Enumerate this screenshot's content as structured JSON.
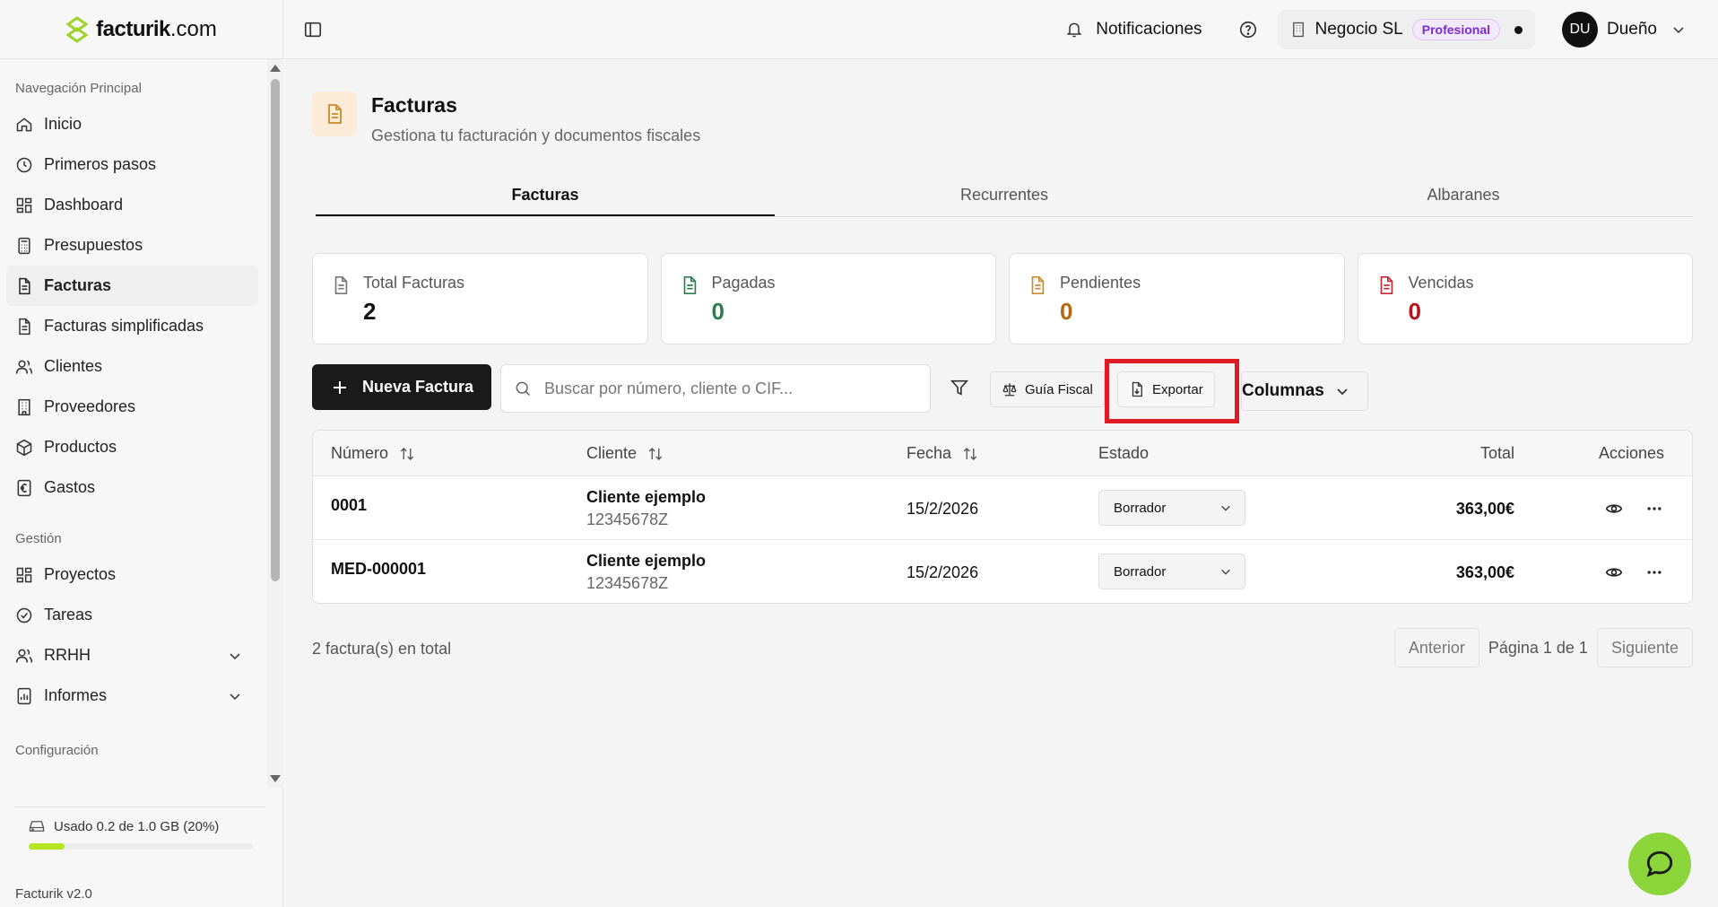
{
  "logo": {
    "brand": "facturik",
    "tld": ".com"
  },
  "sidebar": {
    "section_main": "Navegación Principal",
    "main_items": [
      {
        "label": "Inicio",
        "icon": "home-icon"
      },
      {
        "label": "Primeros pasos",
        "icon": "clock-icon"
      },
      {
        "label": "Dashboard",
        "icon": "dashboard-icon"
      },
      {
        "label": "Presupuestos",
        "icon": "calculator-icon"
      },
      {
        "label": "Facturas",
        "icon": "invoice-icon",
        "active": true
      },
      {
        "label": "Facturas simplificadas",
        "icon": "invoice-icon"
      },
      {
        "label": "Clientes",
        "icon": "users-icon"
      },
      {
        "label": "Proveedores",
        "icon": "building-icon"
      },
      {
        "label": "Productos",
        "icon": "box-icon"
      },
      {
        "label": "Gastos",
        "icon": "euro-receipt-icon"
      }
    ],
    "section_manage": "Gestión",
    "manage_items": [
      {
        "label": "Proyectos",
        "icon": "dashboard-icon"
      },
      {
        "label": "Tareas",
        "icon": "check-circle-icon"
      },
      {
        "label": "RRHH",
        "icon": "users-icon"
      },
      {
        "label": "Informes",
        "icon": "report-icon"
      }
    ],
    "section_config": "Configuración",
    "usage_text": "Usado 0.2 de 1.0 GB (20%)",
    "usage_fraction": 0.16,
    "version": "Facturik v2.0"
  },
  "header": {
    "notifications": "Notificaciones",
    "business": "Negocio SL",
    "plan": "Profesional",
    "avatar_initials": "DU",
    "user_role": "Dueño"
  },
  "page": {
    "title": "Facturas",
    "subtitle": "Gestiona tu facturación y documentos fiscales"
  },
  "tabs": [
    "Facturas",
    "Recurrentes",
    "Albaranes"
  ],
  "stats": [
    {
      "label": "Total Facturas",
      "value": "2",
      "color": "#111111",
      "icon_color": "#777777"
    },
    {
      "label": "Pagadas",
      "value": "0",
      "color": "#2e7d4f",
      "icon_color": "#2e7d4f"
    },
    {
      "label": "Pendientes",
      "value": "0",
      "color": "#b8650f",
      "icon_color": "#c98a2a"
    },
    {
      "label": "Vencidas",
      "value": "0",
      "color": "#b5141c",
      "icon_color": "#c02a30"
    }
  ],
  "toolbar": {
    "new_invoice": "Nueva Factura",
    "search_placeholder": "Buscar por número, cliente o CIF...",
    "fiscal_guide": "Guía Fiscal",
    "export": "Exportar",
    "columns": "Columnas"
  },
  "table": {
    "headers": {
      "number": "Número",
      "client": "Cliente",
      "date": "Fecha",
      "state": "Estado",
      "total": "Total",
      "actions": "Acciones"
    },
    "rows": [
      {
        "number": "0001",
        "client": "Cliente ejemplo",
        "cif": "12345678Z",
        "date": "15/2/2026",
        "state": "Borrador",
        "total": "363,00€"
      },
      {
        "number": "MED-000001",
        "client": "Cliente ejemplo",
        "cif": "12345678Z",
        "date": "15/2/2026",
        "state": "Borrador",
        "total": "363,00€"
      }
    ]
  },
  "footer": {
    "count": "2 factura(s) en total",
    "prev": "Anterior",
    "page_info": "Página 1 de 1",
    "next": "Siguiente"
  },
  "colors": {
    "accent": "#1a1a1a",
    "highlight": "#e01b24",
    "usage": "#b4e51f",
    "chat": "#8bd43a",
    "pro": "#7c2bd6"
  }
}
